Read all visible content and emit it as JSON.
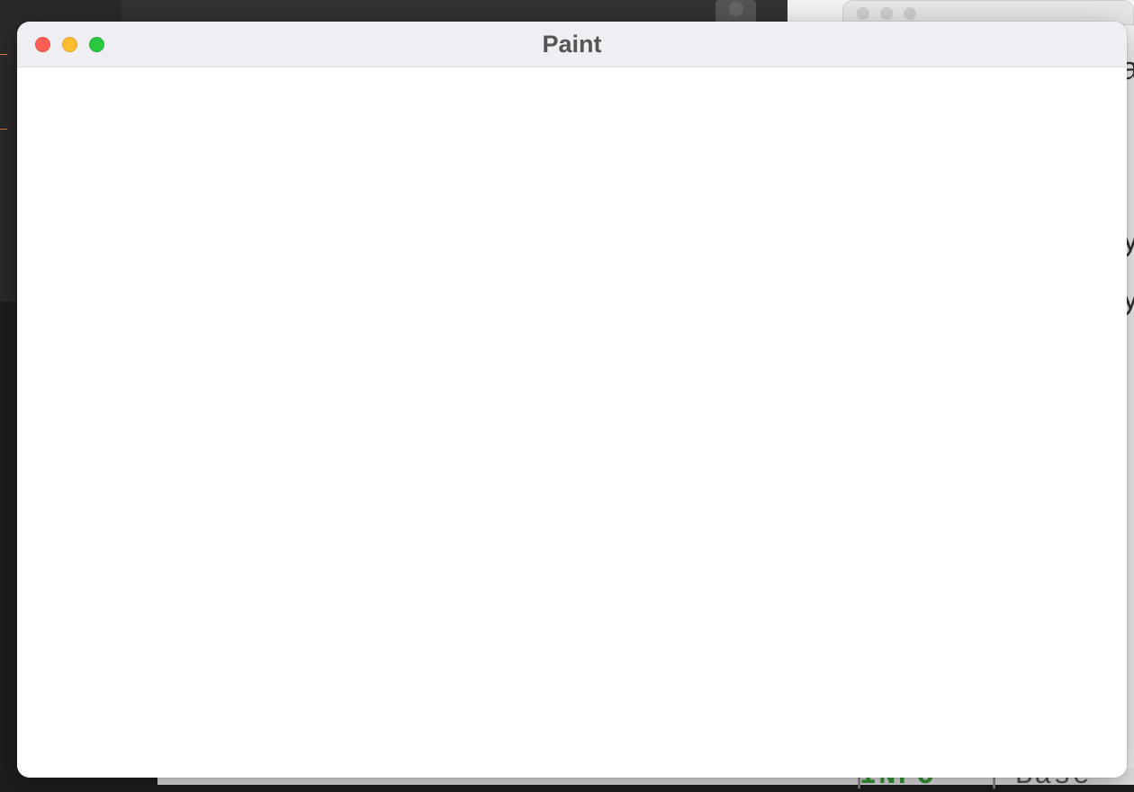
{
  "window": {
    "title": "Paint"
  },
  "background": {
    "right_text_1": "a",
    "right_text_2": "y",
    "right_text_3": "y",
    "bottom_info": "INFO",
    "bottom_base": "Base"
  }
}
